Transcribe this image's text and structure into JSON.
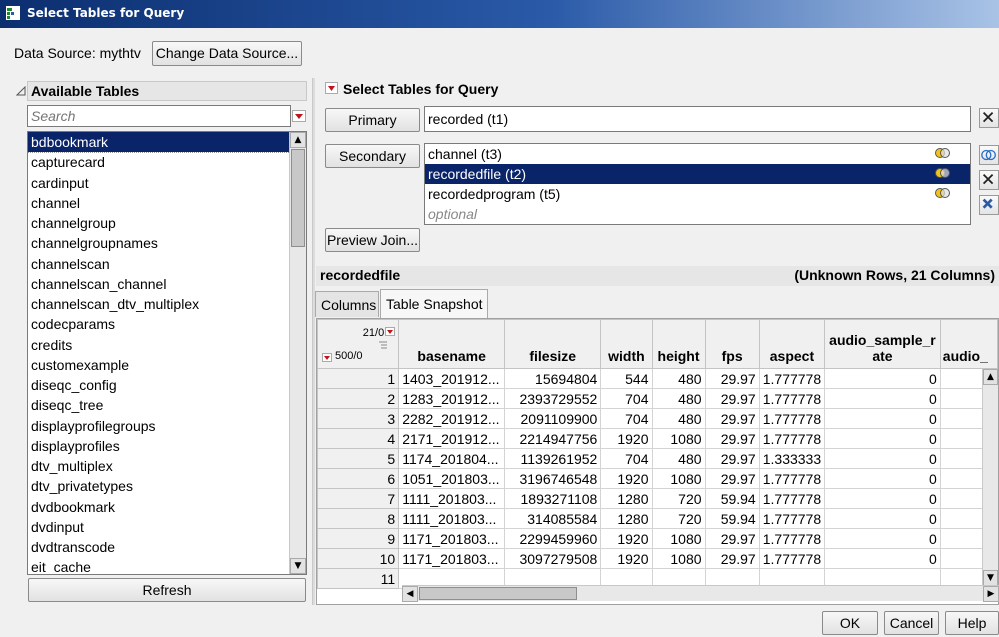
{
  "window": {
    "title": "Select Tables for Query"
  },
  "datasource": {
    "label": "Data Source: mythtv",
    "change_button": "Change Data Source..."
  },
  "available": {
    "header": "Available Tables",
    "search_placeholder": "Search",
    "items": [
      "bdbookmark",
      "capturecard",
      "cardinput",
      "channel",
      "channelgroup",
      "channelgroupnames",
      "channelscan",
      "channelscan_channel",
      "channelscan_dtv_multiplex",
      "codecparams",
      "credits",
      "customexample",
      "diseqc_config",
      "diseqc_tree",
      "displayprofilegroups",
      "displayprofiles",
      "dtv_multiplex",
      "dtv_privatetypes",
      "dvdbookmark",
      "dvdinput",
      "dvdtranscode",
      "eit_cache"
    ],
    "selected_index": 0,
    "refresh_button": "Refresh"
  },
  "query": {
    "header": "Select Tables for Query",
    "primary_button": "Primary",
    "primary_value": "recorded (t1)",
    "secondary_button": "Secondary",
    "secondary_items": [
      {
        "label": "channel (t3)",
        "selected": false
      },
      {
        "label": "recordedfile (t2)",
        "selected": true
      },
      {
        "label": "recordedprogram (t5)",
        "selected": false
      }
    ],
    "optional_placeholder": "optional",
    "preview_button": "Preview Join..."
  },
  "snapshot": {
    "table_name": "recordedfile",
    "summary": "(Unknown Rows, 21 Columns)",
    "tabs": [
      "Columns",
      "Table Snapshot"
    ],
    "active_tab": 1,
    "corner_top": "21/0",
    "corner_bottom": "500/0",
    "columns": [
      "basename",
      "filesize",
      "width",
      "height",
      "fps",
      "aspect",
      "audio_sample_rate",
      "audio_"
    ],
    "rows": [
      [
        "1",
        "1403_201912...",
        "15694804",
        "544",
        "480",
        "29.97",
        "1.777778",
        "0"
      ],
      [
        "2",
        "1283_201912...",
        "2393729552",
        "704",
        "480",
        "29.97",
        "1.777778",
        "0"
      ],
      [
        "3",
        "2282_201912...",
        "2091109900",
        "704",
        "480",
        "29.97",
        "1.777778",
        "0"
      ],
      [
        "4",
        "2171_201912...",
        "2214947756",
        "1920",
        "1080",
        "29.97",
        "1.777778",
        "0"
      ],
      [
        "5",
        "1174_201804...",
        "1139261952",
        "704",
        "480",
        "29.97",
        "1.333333",
        "0"
      ],
      [
        "6",
        "1051_201803...",
        "3196746548",
        "1920",
        "1080",
        "29.97",
        "1.777778",
        "0"
      ],
      [
        "7",
        "1111_201803...",
        "1893271108",
        "1280",
        "720",
        "59.94",
        "1.777778",
        "0"
      ],
      [
        "8",
        "1111_201803...",
        "314085584",
        "1280",
        "720",
        "59.94",
        "1.777778",
        "0"
      ],
      [
        "9",
        "1171_201803...",
        "2299459960",
        "1920",
        "1080",
        "29.97",
        "1.777778",
        "0"
      ],
      [
        "10",
        "1171_201803...",
        "3097279508",
        "1920",
        "1080",
        "29.97",
        "1.777778",
        "0"
      ],
      [
        "11",
        "",
        "",
        "",
        "",
        "",
        "",
        ""
      ]
    ]
  },
  "footer": {
    "ok": "OK",
    "cancel": "Cancel",
    "help": "Help"
  },
  "colors": {
    "selection": "#0a246a",
    "titlebar": "#0b2e6f",
    "accent_red": "#c0141c"
  }
}
